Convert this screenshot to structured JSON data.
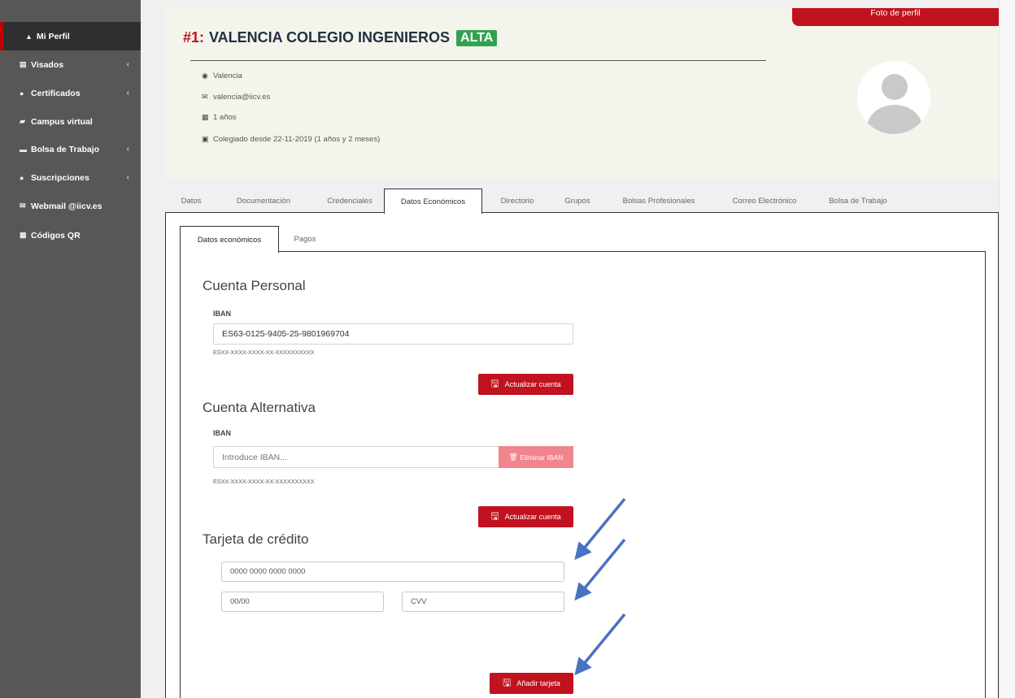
{
  "sidebar": {
    "items": [
      {
        "label": "Mi Perfil",
        "icon": "user-icon",
        "glyph": "▲",
        "chevron": ""
      },
      {
        "label": "Visados",
        "icon": "file-icon",
        "glyph": "▤",
        "chevron": "‹"
      },
      {
        "label": "Certificados",
        "icon": "certificate-icon",
        "glyph": "●",
        "chevron": "‹"
      },
      {
        "label": "Campus virtual",
        "icon": "book-icon",
        "glyph": "▰",
        "chevron": ""
      },
      {
        "label": "Bolsa de Trabajo",
        "icon": "briefcase-icon",
        "glyph": "▬",
        "chevron": "‹"
      },
      {
        "label": "Suscripciones",
        "icon": "comment-icon",
        "glyph": "●",
        "chevron": "‹"
      },
      {
        "label": "Webmail @iicv.es",
        "icon": "envelope-icon",
        "glyph": "✉",
        "chevron": ""
      },
      {
        "label": "Códigos QR",
        "icon": "qrcode-icon",
        "glyph": "▦",
        "chevron": ""
      }
    ]
  },
  "profile": {
    "number": "#1:",
    "name": "VALENCIA COLEGIO INGENIEROS",
    "badge": "ALTA",
    "location": "Valencia",
    "email": "valencia@iicv.es",
    "years": "1 años",
    "since": "Colegiado desde 22-11-2019 (1 años y 2 meses)",
    "photo_tab": "Foto de perfil"
  },
  "main_tabs": [
    "Datos",
    "Documentación",
    "Credenciales",
    "Datos Económicos",
    "Directorio",
    "Grupos",
    "Bolsas Profesionales",
    "Correo Electrónico",
    "Bolsa de Trabajo"
  ],
  "sub_tabs": [
    "Datos económicos",
    "Pagos"
  ],
  "personal": {
    "title": "Cuenta Personal",
    "iban_label": "IBAN",
    "iban_value": "ES63-0125-9405-25-9801969704",
    "hint": "ESXX-XXXX-XXXX-XX-XXXXXXXXXX",
    "button": "Actualizar cuenta"
  },
  "alternative": {
    "title": "Cuenta Alternativa",
    "iban_label": "IBAN",
    "placeholder": "Introduce IBAN...",
    "delete_button": "Eliminar IBAN",
    "hint": "ESXX-XXXX-XXXX-XX-XXXXXXXXXX",
    "button": "Actualizar cuenta"
  },
  "card": {
    "title": "Tarjeta de crédito",
    "number_placeholder": "0000 0000 0000 0000",
    "expiry_placeholder": "00/00",
    "cvv_placeholder": "CVV",
    "button": "Añadir tarjeta"
  },
  "colors": {
    "accent_red": "#c0121f",
    "badge_green": "#2ea44f",
    "annotation_arrow": "#4a72c4",
    "sidebar": "#575757"
  }
}
